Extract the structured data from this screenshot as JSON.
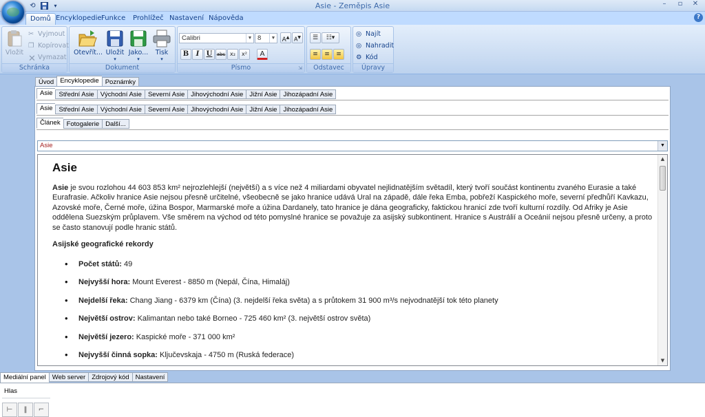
{
  "window": {
    "title": "Asie - Zeměpis Asie",
    "controls": [
      "–",
      "▫",
      "✕"
    ]
  },
  "ribbon": {
    "tabs": [
      "Domů",
      "Encyklopedie",
      "Funkce",
      "Prohlížeč",
      "Nastavení",
      "Nápověda"
    ],
    "active_tab": "Domů",
    "groups": {
      "clipboard": {
        "label": "Schránka",
        "paste": "Vložit",
        "cut": "Vyjmout",
        "copy": "Kopírovat",
        "delete": "Vymazat"
      },
      "document": {
        "label": "Dokument",
        "open": "Otevřít...",
        "save": "Uložit",
        "save_as": "Jako...",
        "print": "Tisk"
      },
      "font": {
        "label": "Písmo",
        "font_name": "Calibri",
        "font_size": "8",
        "bold": "B",
        "italic": "I",
        "underline": "U",
        "strike": "abc",
        "subscript": "x₂",
        "superscript": "x²",
        "color": "A"
      },
      "paragraph": {
        "label": "Odstavec"
      },
      "editing": {
        "label": "Úpravy",
        "find": "Najít",
        "replace": "Nahradit",
        "code": "Kód"
      }
    }
  },
  "doc_tabs": [
    "Úvod",
    "Encyklopedie",
    "Poznámky"
  ],
  "region_tabs_1": [
    "Asie",
    "Střední Asie",
    "Východní Asie",
    "Severní Asie",
    "Jihovýchodní Asie",
    "Jižní Asie",
    "Jihozápadní Asie"
  ],
  "region_tabs_2": [
    "Asie",
    "Střední Asie",
    "Východní Asie",
    "Severní Asie",
    "Jihovýchodní Asie",
    "Jižní Asie",
    "Jihozápadní Asie"
  ],
  "content_tabs": [
    "Článek",
    "Fotogalerie",
    "Další..."
  ],
  "address": "Asie",
  "article": {
    "heading": "Asie",
    "lead_bold": "Asie",
    "lead_text": " je svou rozlohou 44 603 853 km² nejrozlehlejší (největší) a s více než 4 miliardami obyvatel nejlidnatějším světadíl, který tvoří součást kontinentu zvaného Eurasie a také Eurafrasie. Ačkoliv hranice Asie nejsou přesně určitelné, všeobecně se jako hranice udává Ural na západě, dále řeka Emba, pobřeží Kaspického moře, severní předhůří Kavkazu, Azovské moře, Černé moře, úžina Bospor, Marmarské moře a úžina Dardanely, tato hranice je dána geograficky, faktickou hranicí zde tvoří kulturní rozdíly. Od Afriky je Asie oddělena Suezským průplavem. Vše směrem na východ od této pomyslné hranice se považuje za asijský subkontinent. Hranice s Austrálií a Oceánií nejsou přesně určeny, a proto se často stanovují podle hranic států.",
    "subheading": "Asijské geografické rekordy",
    "records": [
      {
        "label": "Počet států:",
        "value": " 49"
      },
      {
        "label": "Nejvyšší hora:",
        "value": " Mount Everest - 8850 m (Nepál, Čína, Himaláj)"
      },
      {
        "label": "Nejdelší řeka:",
        "value": " Chang Jiang - 6379 km (Čína) (3. nejdelší řeka světa) a s průtokem 31 900 m³/s nejvodnatější tok této planety"
      },
      {
        "label": "Největší ostrov:",
        "value": " Kalimantan nebo také Borneo - 725 460 km² (3. největší ostrov světa)"
      },
      {
        "label": "Největší jezero:",
        "value": " Kaspické moře - 371 000 km²"
      },
      {
        "label": "Nejvyšší činná sopka:",
        "value": " Ključevskaja - 4750 m (Ruská federace)"
      }
    ]
  },
  "bottom_tabs": [
    "Mediální panel",
    "Web server",
    "Zdrojový kód",
    "Nastavení"
  ],
  "media": {
    "label": "Hlas",
    "buttons": [
      "⊢",
      "‖",
      "⌐"
    ]
  }
}
